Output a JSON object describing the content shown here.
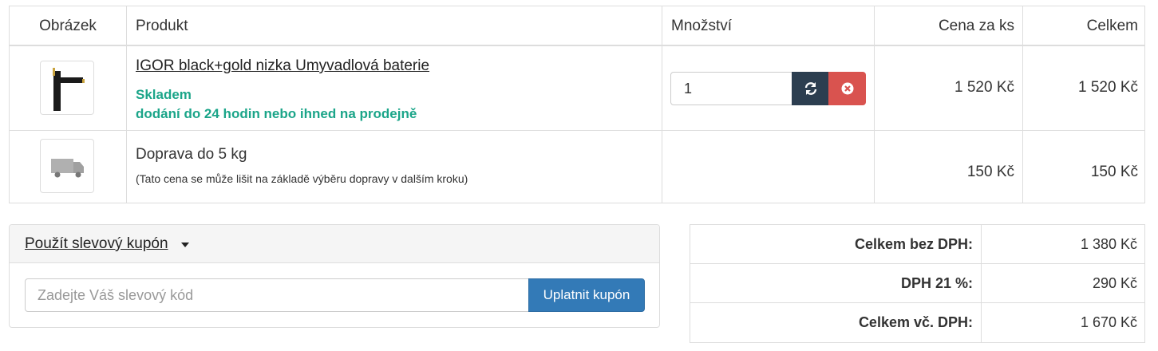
{
  "cart": {
    "headers": {
      "image": "Obrázek",
      "product": "Produkt",
      "quantity": "Množství",
      "unit_price": "Cena za ks",
      "total": "Celkem"
    },
    "items": [
      {
        "name": "IGOR black+gold nizka Umyvadlová baterie",
        "stock": "Skladem",
        "delivery": "dodání do 24 hodin nebo ihned na prodejně",
        "quantity": "1",
        "unit_price": "1 520 Kč",
        "total": "1 520 Kč",
        "icons": [
          "faucet-image",
          "refresh-icon",
          "remove-icon"
        ]
      }
    ],
    "shipping": {
      "name": "Doprava do 5 kg",
      "note": "(Tato cena se může lišit na základě výběru dopravy v dalším kroku)",
      "unit_price": "150 Kč",
      "total": "150 Kč",
      "icon": "delivery-truck-image"
    }
  },
  "coupon": {
    "title": "Použít slevový kupón",
    "placeholder": "Zadejte Váš slevový kód",
    "button": "Uplatnit kupón"
  },
  "totals": [
    {
      "label": "Celkem bez DPH:",
      "value": "1 380 Kč"
    },
    {
      "label": "DPH 21 %:",
      "value": "290 Kč"
    },
    {
      "label": "Celkem vč. DPH:",
      "value": "1 670 Kč"
    }
  ],
  "colors": {
    "stock_green": "#1ba589",
    "refresh_button": "#2c3e50",
    "remove_button": "#d9534f",
    "coupon_button": "#337ab7"
  }
}
